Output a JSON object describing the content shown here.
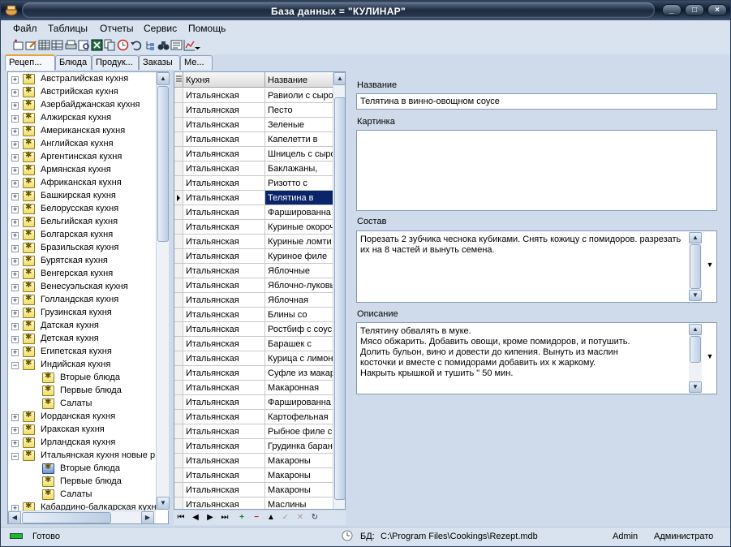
{
  "window": {
    "title": "База данных = \"КУЛИНАР\"",
    "minimize": "_",
    "maximize": "□",
    "close": "×"
  },
  "menu": [
    "Файл",
    "Таблицы",
    "Отчеты",
    "Сервис",
    "Помощь"
  ],
  "toolbar_icons": [
    "new-record-icon",
    "edit-icon",
    "table-icon",
    "grid-icon",
    "print-icon",
    "preview-icon",
    "excel-icon",
    "copy-icon",
    "clock-icon",
    "undo-icon",
    "tree-icon",
    "binoculars-icon",
    "card-icon",
    "chart-icon",
    "dropdown-arrow-icon"
  ],
  "tabs": [
    "Рецеп...",
    "Блюда",
    "Продук...",
    "Заказы",
    "Ме..."
  ],
  "tree": [
    {
      "label": "Австралийская кухня",
      "level": 0,
      "expanded": false
    },
    {
      "label": "Австрийская кухня",
      "level": 0,
      "expanded": false
    },
    {
      "label": "Азербайджанская кухня",
      "level": 0,
      "expanded": false
    },
    {
      "label": "Алжирская кухня",
      "level": 0,
      "expanded": false
    },
    {
      "label": "Американская кухня",
      "level": 0,
      "expanded": false
    },
    {
      "label": "Английская кухня",
      "level": 0,
      "expanded": false
    },
    {
      "label": "Аргентинская кухня",
      "level": 0,
      "expanded": false
    },
    {
      "label": "Армянская кухня",
      "level": 0,
      "expanded": false
    },
    {
      "label": "Африканская кухня",
      "level": 0,
      "expanded": false
    },
    {
      "label": "Башкирская кухня",
      "level": 0,
      "expanded": false
    },
    {
      "label": "Белорусская кухня",
      "level": 0,
      "expanded": false
    },
    {
      "label": "Бельгийская кухня",
      "level": 0,
      "expanded": false
    },
    {
      "label": "Болгарская кухня",
      "level": 0,
      "expanded": false
    },
    {
      "label": "Бразильская кухня",
      "level": 0,
      "expanded": false
    },
    {
      "label": "Бурятская кухня",
      "level": 0,
      "expanded": false
    },
    {
      "label": "Венгерская кухня",
      "level": 0,
      "expanded": false
    },
    {
      "label": "Венесуэльская кухня",
      "level": 0,
      "expanded": false
    },
    {
      "label": "Голландская кухня",
      "level": 0,
      "expanded": false
    },
    {
      "label": "Грузинская кухня",
      "level": 0,
      "expanded": false
    },
    {
      "label": "Датская кухня",
      "level": 0,
      "expanded": false
    },
    {
      "label": "Детская кухня",
      "level": 0,
      "expanded": false
    },
    {
      "label": "Египетская кухня",
      "level": 0,
      "expanded": false
    },
    {
      "label": "Индийская кухня",
      "level": 0,
      "expanded": true
    },
    {
      "label": "Вторые блюда",
      "level": 1
    },
    {
      "label": "Первые блюда",
      "level": 1
    },
    {
      "label": "Салаты",
      "level": 1
    },
    {
      "label": "Иорданская кухня",
      "level": 0,
      "expanded": false
    },
    {
      "label": "Иракская кухня",
      "level": 0,
      "expanded": false
    },
    {
      "label": "Ирландская кухня",
      "level": 0,
      "expanded": false
    },
    {
      "label": "Итальянская кухня новые р",
      "level": 0,
      "expanded": true
    },
    {
      "label": "Вторые блюда",
      "level": 1,
      "selected": true
    },
    {
      "label": "Первые блюда",
      "level": 1
    },
    {
      "label": "Салаты",
      "level": 1
    },
    {
      "label": "Кабардино-балкарская кухн",
      "level": 0,
      "expanded": false
    }
  ],
  "grid": {
    "columns": [
      "Кухня",
      "Название"
    ],
    "rows": [
      [
        "Итальянская",
        "Равиоли с сыро"
      ],
      [
        "Итальянская",
        "Песто"
      ],
      [
        "Итальянская",
        "Зеленые"
      ],
      [
        "Итальянская",
        "Капелетти в"
      ],
      [
        "Итальянская",
        "Шницель с сыро"
      ],
      [
        "Итальянская",
        "Баклажаны,"
      ],
      [
        "Итальянская",
        "Ризотто с"
      ],
      [
        "Итальянская",
        "Телятина в"
      ],
      [
        "Итальянская",
        "Фаршированна"
      ],
      [
        "Итальянская",
        "Куриные окороч"
      ],
      [
        "Итальянская",
        "Куриные ломти"
      ],
      [
        "Итальянская",
        "Куриное филе"
      ],
      [
        "Итальянская",
        "Яблочные"
      ],
      [
        "Итальянская",
        "Яблочно-луковы"
      ],
      [
        "Итальянская",
        "Яблочная"
      ],
      [
        "Итальянская",
        "Блины со"
      ],
      [
        "Итальянская",
        "Ростбиф с соус"
      ],
      [
        "Итальянская",
        "Барашек с"
      ],
      [
        "Итальянская",
        "Курица с лимон"
      ],
      [
        "Итальянская",
        "Суфле из макар"
      ],
      [
        "Итальянская",
        "Макаронная"
      ],
      [
        "Итальянская",
        "Фаршированна"
      ],
      [
        "Итальянская",
        "Картофельная"
      ],
      [
        "Итальянская",
        "Рыбное филе с"
      ],
      [
        "Итальянская",
        "Грудинка баран"
      ],
      [
        "Итальянская",
        "Макароны"
      ],
      [
        "Итальянская",
        "Макароны"
      ],
      [
        "Итальянская",
        "Макароны"
      ],
      [
        "Итальянская",
        "Маслины"
      ]
    ],
    "selected_row": 7
  },
  "navigator": [
    "⏮",
    "◀",
    "▶",
    "⏭",
    "+",
    "−",
    "▲",
    "✓",
    "✕",
    "↻"
  ],
  "form": {
    "name_label": "Название",
    "name_value": "Телятина в винно-овощном соусе",
    "picture_label": "Картинка",
    "composition_label": "Состав",
    "composition_value": "Порезать 2 зубчика чеснока кубиками. Снять кожицу с помидоров. разрезать\nих на 8 частей и вынуть семена.",
    "description_label": "Описание",
    "description_value": "Телятину обвалять в муке.\nМясо обжарить. Добавить овощи, кроме помидоров, и потушить.\nДолить бульон, вино и довести до кипения. Вынуть из маслин\nкосточки и вместе с помидорами добавить их к жаркому.\nНакрыть крышкой и тушить \" 50 мин."
  },
  "status": {
    "ready": "Готово",
    "db_label": "БД:",
    "db_path": "C:\\Program Files\\Cookings\\Rezept.mdb",
    "user": "Admin",
    "role": "Администрато"
  },
  "colors": {
    "selection": "#0a246a",
    "active_tab_accent": "#e8a53c",
    "status_led": "#22b33a"
  }
}
